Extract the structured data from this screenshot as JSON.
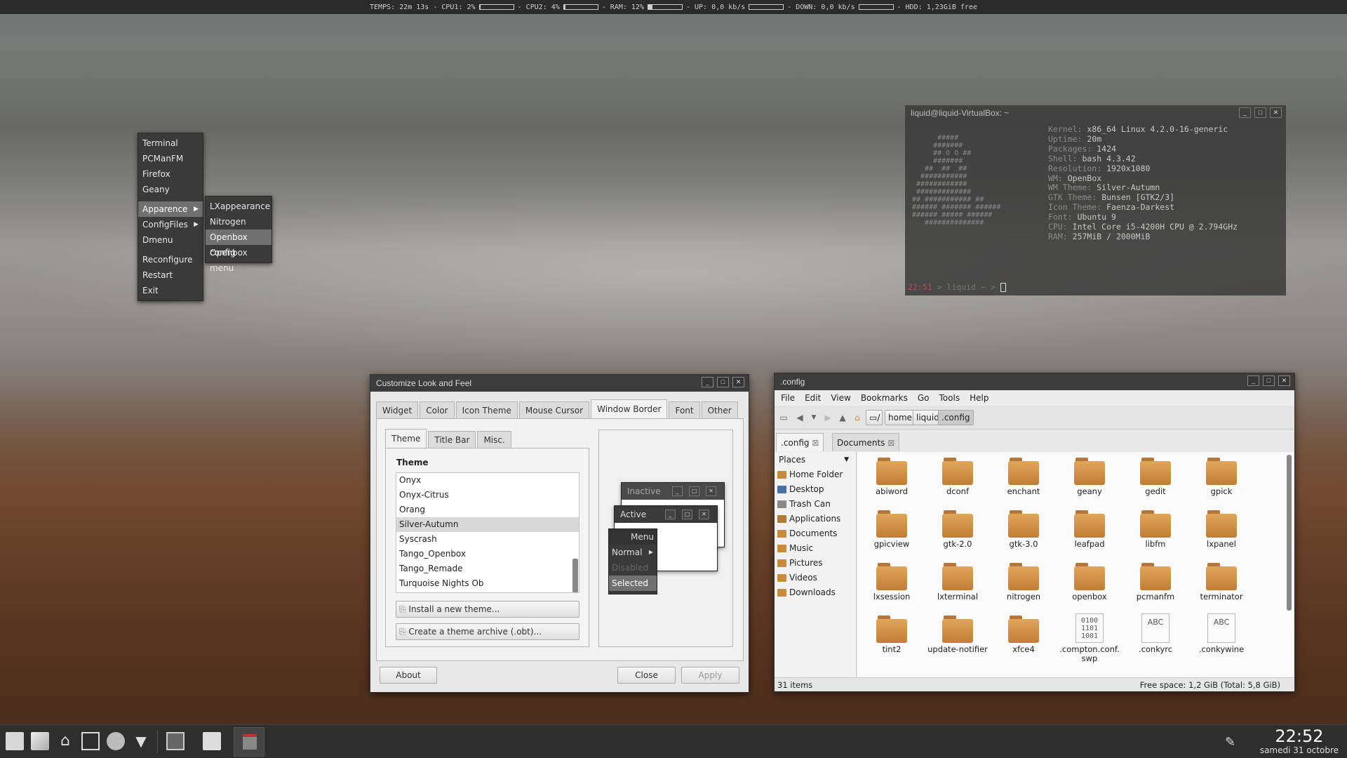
{
  "conky": {
    "text1": "TEMPS: 22m 13s - CPU1: 2%",
    "cpu1_fraction": 0.02,
    "text2": "- CPU2: 4%",
    "cpu2_fraction": 0.04,
    "text3": "- RAM: 12%",
    "ram_fraction": 0.12,
    "text4": "- UP: 0,0 kb/s",
    "text5": "- DOWN: 0,0 kb/s",
    "text6": "- HDD: 1,23GiB free"
  },
  "root_menu": {
    "items": [
      "Terminal",
      "PCManFM",
      "Firefox",
      "Geany",
      "Apparence",
      "ConfigFiles",
      "Dmenu",
      "Reconfigure",
      "Restart",
      "Exit"
    ]
  },
  "sub_menu": {
    "items": [
      "LXappearance",
      "Nitrogen",
      "Openbox config",
      "Openbox menu"
    ]
  },
  "terminal": {
    "title": "liquid@liquid-VirtualBox: ~",
    "ascii": "      #####\n     #######\n     ## O O ##\n     #######\n   ##  ##  ##\n  ###########\n ############\n #############\n## ########### ##\n###### ####### ######\n###### ##### ######\n   ##############",
    "info": [
      {
        "k": "Kernel:",
        "v": "x86_64 Linux 4.2.0-16-generic"
      },
      {
        "k": "Uptime:",
        "v": "20m"
      },
      {
        "k": "Packages:",
        "v": "1424"
      },
      {
        "k": "Shell:",
        "v": "bash 4.3.42"
      },
      {
        "k": "Resolution:",
        "v": "1920x1080"
      },
      {
        "k": "WM:",
        "v": "OpenBox"
      },
      {
        "k": "WM Theme:",
        "v": "Silver-Autumn"
      },
      {
        "k": "GTK Theme:",
        "v": "Bunsen [GTK2/3]"
      },
      {
        "k": "Icon Theme:",
        "v": "Faenza-Darkest"
      },
      {
        "k": "Font:",
        "v": "Ubuntu 9"
      },
      {
        "k": "CPU:",
        "v": "Intel Core i5-4200H CPU @ 2.794GHz"
      },
      {
        "k": "RAM:",
        "v": "257MiB / 2000MiB"
      }
    ],
    "prompt_time": "22:51",
    "prompt_rest": " > liquid ~ >"
  },
  "lxappearance": {
    "title": "Customize Look and Feel",
    "tabs": [
      "Widget",
      "Color",
      "Icon Theme",
      "Mouse Cursor",
      "Window Border",
      "Font",
      "Other"
    ],
    "subtabs": [
      "Theme",
      "Title Bar",
      "Misc."
    ],
    "theme_heading": "Theme",
    "themes": [
      "Onyx",
      "Onyx-Citrus",
      "Orang",
      "Silver-Autumn",
      "Syscrash",
      "Tango_Openbox",
      "Tango_Remade",
      "Turquoise Nights Ob"
    ],
    "install_btn": "Install a new theme...",
    "archive_btn": "Create a theme archive (.obt)...",
    "preview": {
      "inactive": "Inactive",
      "active": "Active",
      "menu": "Menu",
      "normal": "Normal",
      "disabled": "Disabled",
      "selected": "Selected"
    },
    "about_btn": "About",
    "close_btn": "Close",
    "apply_btn": "Apply"
  },
  "filemanager": {
    "title": ".config",
    "menu": [
      "File",
      "Edit",
      "View",
      "Bookmarks",
      "Go",
      "Tools",
      "Help"
    ],
    "path": [
      "/",
      "home",
      "liquid",
      ".config"
    ],
    "tabs": [
      ".config",
      "Documents"
    ],
    "places_label": "Places",
    "places": [
      {
        "name": "Home Folder",
        "color": "#c98a3e"
      },
      {
        "name": "Desktop",
        "color": "#4a6fa5"
      },
      {
        "name": "Trash Can",
        "color": "#8a8a8a"
      },
      {
        "name": "Applications",
        "color": "#b07a3a"
      },
      {
        "name": "Documents",
        "color": "#c98a3e"
      },
      {
        "name": "Music",
        "color": "#c98a3e"
      },
      {
        "name": "Pictures",
        "color": "#c98a3e"
      },
      {
        "name": "Videos",
        "color": "#c98a3e"
      },
      {
        "name": "Downloads",
        "color": "#c98a3e"
      }
    ],
    "files": [
      {
        "name": "abiword",
        "kind": "folder"
      },
      {
        "name": "dconf",
        "kind": "folder"
      },
      {
        "name": "enchant",
        "kind": "folder"
      },
      {
        "name": "geany",
        "kind": "folder"
      },
      {
        "name": "gedit",
        "kind": "folder"
      },
      {
        "name": "gpick",
        "kind": "folder"
      },
      {
        "name": "gpicview",
        "kind": "folder"
      },
      {
        "name": "gtk-2.0",
        "kind": "folder"
      },
      {
        "name": "gtk-3.0",
        "kind": "folder"
      },
      {
        "name": "leafpad",
        "kind": "folder"
      },
      {
        "name": "libfm",
        "kind": "folder"
      },
      {
        "name": "lxpanel",
        "kind": "folder"
      },
      {
        "name": "lxsession",
        "kind": "folder"
      },
      {
        "name": "lxterminal",
        "kind": "folder"
      },
      {
        "name": "nitrogen",
        "kind": "folder"
      },
      {
        "name": "openbox",
        "kind": "folder"
      },
      {
        "name": "pcmanfm",
        "kind": "folder"
      },
      {
        "name": "terminator",
        "kind": "folder"
      },
      {
        "name": "tint2",
        "kind": "folder"
      },
      {
        "name": "update-notifier",
        "kind": "folder"
      },
      {
        "name": "xfce4",
        "kind": "folder"
      },
      {
        "name": ".compton.conf.swp",
        "kind": "binary",
        "glyph": "0100\n1101\n1001"
      },
      {
        "name": ".conkyrc",
        "kind": "text",
        "glyph": "ABC"
      },
      {
        "name": ".conkywine",
        "kind": "text",
        "glyph": "ABC"
      }
    ],
    "status_left": "31 items",
    "status_right": "Free space: 1,2 GiB (Total: 5,8 GiB)"
  },
  "taskbar": {
    "time": "22:52",
    "date": "samedi 31 octobre"
  }
}
